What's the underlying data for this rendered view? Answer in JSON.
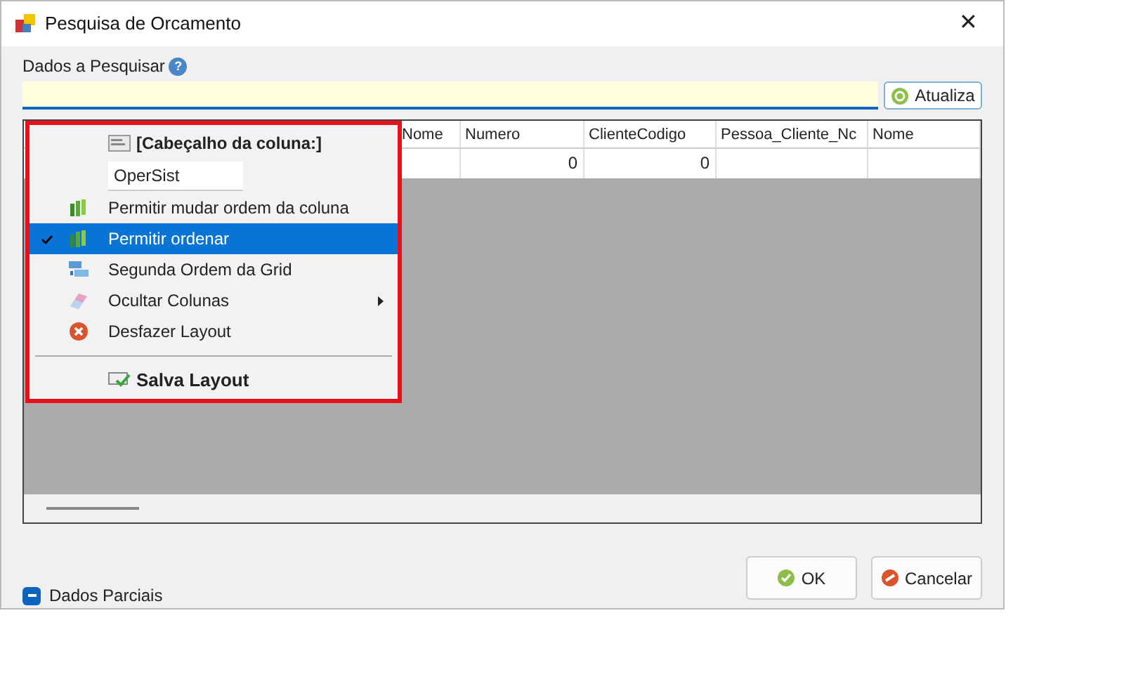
{
  "window": {
    "title": "Pesquisa de Orcamento",
    "close": "✕"
  },
  "search": {
    "label": "Dados a Pesquisar",
    "help": "?",
    "button": "Atualiza"
  },
  "table": {
    "columns": [
      {
        "label": "Nome"
      },
      {
        "label": "Numero"
      },
      {
        "label": "ClienteCodigo"
      },
      {
        "label": "Pessoa_Cliente_Nc"
      },
      {
        "label": "Nome"
      }
    ],
    "rows": [
      [
        "",
        "0",
        "0",
        "",
        ""
      ]
    ]
  },
  "context_menu": {
    "items": [
      {
        "kind": "header",
        "label": "[Cabeçalho da coluna:]"
      },
      {
        "kind": "field",
        "value": "OperSist"
      },
      {
        "kind": "item",
        "label": "Permitir mudar ordem da coluna",
        "checked": false,
        "selected": false,
        "submenu": false
      },
      {
        "kind": "item",
        "label": "Permitir ordenar",
        "checked": true,
        "selected": true,
        "submenu": false
      },
      {
        "kind": "item",
        "label": "Segunda Ordem da Grid",
        "checked": false,
        "selected": false,
        "submenu": false
      },
      {
        "kind": "item",
        "label": "Ocultar Colunas",
        "checked": false,
        "selected": false,
        "submenu": true
      },
      {
        "kind": "item",
        "label": "Desfazer Layout",
        "checked": false,
        "selected": false,
        "submenu": false
      },
      {
        "kind": "separator"
      },
      {
        "kind": "action",
        "label": "Salva Layout"
      }
    ]
  },
  "partial": {
    "label": "Dados Parciais",
    "indeterminate": true
  },
  "buttons": [
    {
      "kind": "ok",
      "label": "OK"
    },
    {
      "kind": "cancel",
      "label": "Cancelar"
    }
  ]
}
